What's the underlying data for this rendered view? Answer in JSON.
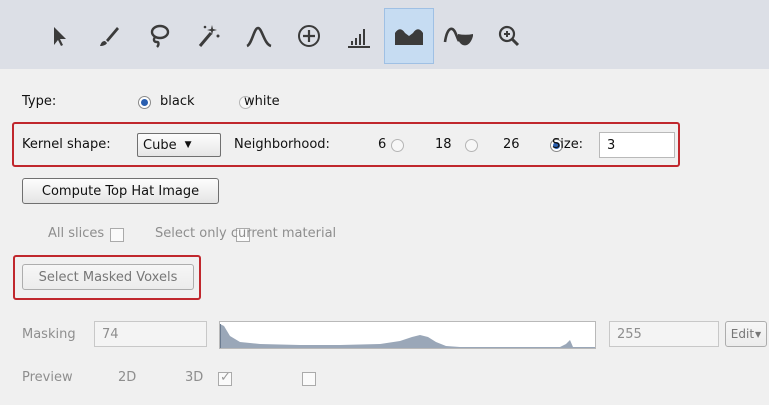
{
  "toolbar": {
    "tools": [
      {
        "icon": "pointer-arrow-icon"
      },
      {
        "icon": "brush-icon"
      },
      {
        "icon": "lasso-icon"
      },
      {
        "icon": "magic-wand-icon"
      },
      {
        "icon": "threshold-curve-icon"
      },
      {
        "icon": "crosshair-plus-icon"
      },
      {
        "icon": "histogram-threshold-icon"
      },
      {
        "icon": "top-hat-icon"
      },
      {
        "icon": "watershed-icon"
      },
      {
        "icon": "zoom-in-icon"
      }
    ],
    "active_index": 7
  },
  "type_row": {
    "label": "Type:",
    "options": [
      "black",
      "white"
    ],
    "selected": "black"
  },
  "kernel_row": {
    "kernel_label": "Kernel shape:",
    "kernel_value": "Cube",
    "neighborhood_label": "Neighborhood:",
    "neighborhood_options": [
      "6",
      "18",
      "26"
    ],
    "neighborhood_selected": "26",
    "size_label": "Size:",
    "size_value": "3"
  },
  "compute_button": "Compute Top Hat Image",
  "options_row": {
    "all_slices": "All slices",
    "select_current_material": "Select only current material"
  },
  "select_masked_button": "Select Masked Voxels",
  "masking": {
    "label": "Masking",
    "min_value": "74",
    "max_value": "255",
    "edit_label": "Edit"
  },
  "preview": {
    "label": "Preview",
    "option_2d": "2D",
    "option_3d": "3D",
    "checked_2d": true,
    "checked_3d": false
  },
  "colors": {
    "toolbar_bg": "#dcdfe6",
    "active_tool_bg": "#c6dcf2",
    "highlight_frame": "#c0272d",
    "histogram_fill": "#9aa7b8"
  }
}
